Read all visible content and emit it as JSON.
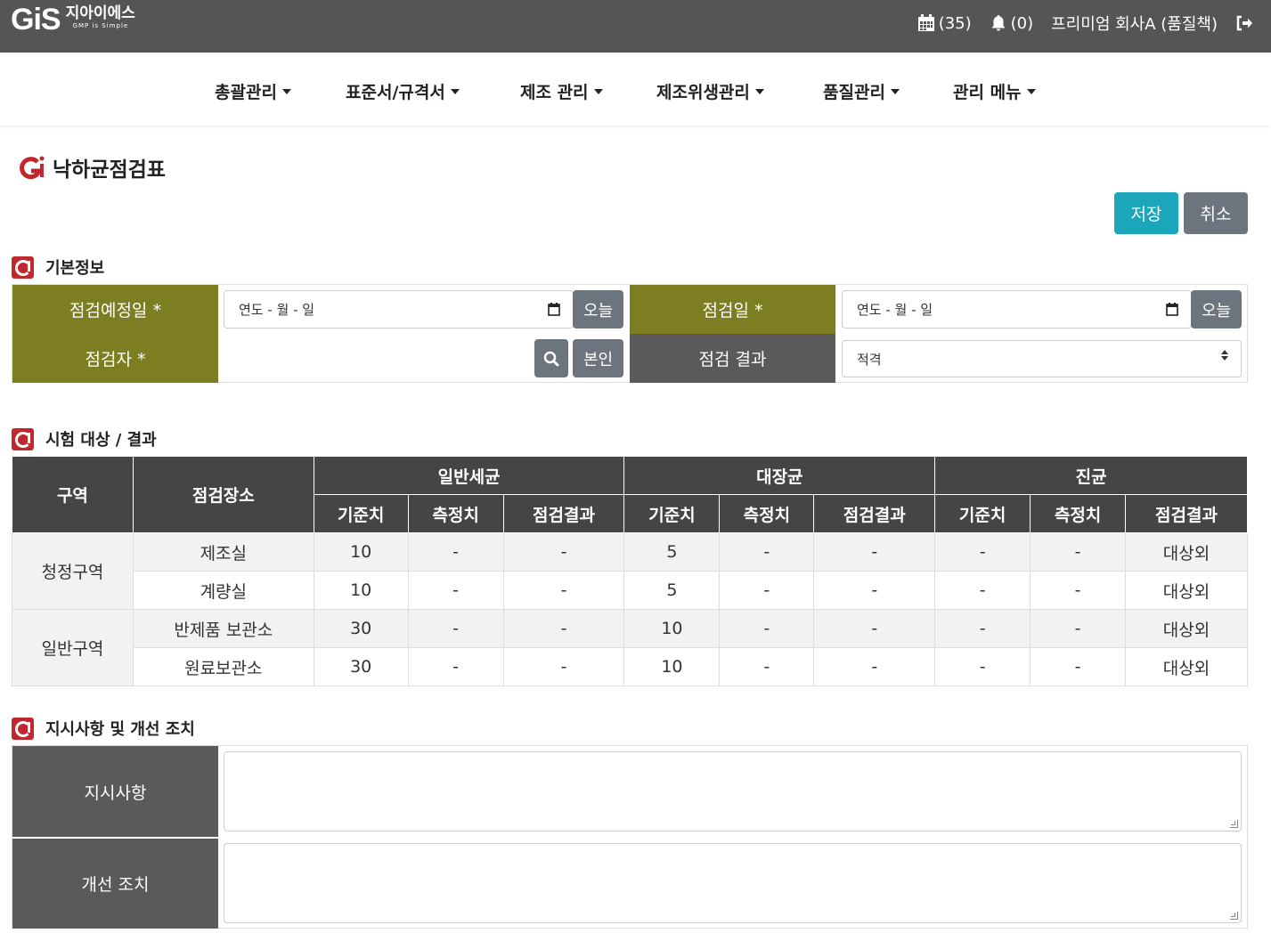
{
  "header": {
    "logo_mark": "GiS",
    "logo_name": "지아이에스",
    "logo_sub": "GMP is Simple",
    "calendar_count": "(35)",
    "notification_count": "(0)",
    "user": "프리미엄 회사A (품질책)"
  },
  "nav": {
    "items": [
      "총괄관리",
      "표준서/규격서",
      "제조 관리",
      "제조위생관리",
      "품질관리",
      "관리 메뉴"
    ]
  },
  "page": {
    "title": "낙하균점검표",
    "save_label": "저장",
    "cancel_label": "취소"
  },
  "basic_info": {
    "section_title": "기본정보",
    "scheduled_date_label": "점검예정일 *",
    "scheduled_date_placeholder": "연도 - 월 - 일",
    "today_label": "오늘",
    "inspection_date_label": "점검일 *",
    "inspection_date_placeholder": "연도 - 월 - 일",
    "inspector_label": "점검자 *",
    "inspector_value": "",
    "self_label": "본인",
    "result_label": "점검 결과",
    "result_value": "적격"
  },
  "results": {
    "section_title": "시험 대상 / 결과",
    "headers": {
      "area": "구역",
      "place": "점검장소",
      "groups": [
        "일반세균",
        "대장균",
        "진균"
      ],
      "sub": [
        "기준치",
        "측정치",
        "점검결과"
      ]
    },
    "areas": [
      "청정구역",
      "일반구역"
    ],
    "rows": [
      {
        "place": "제조실",
        "values": [
          "10",
          "-",
          "-",
          "5",
          "-",
          "-",
          "-",
          "-",
          "대상외"
        ]
      },
      {
        "place": "계량실",
        "values": [
          "10",
          "-",
          "-",
          "5",
          "-",
          "-",
          "-",
          "-",
          "대상외"
        ]
      },
      {
        "place": "반제품 보관소",
        "values": [
          "30",
          "-",
          "-",
          "10",
          "-",
          "-",
          "-",
          "-",
          "대상외"
        ]
      },
      {
        "place": "원료보관소",
        "values": [
          "30",
          "-",
          "-",
          "10",
          "-",
          "-",
          "-",
          "-",
          "대상외"
        ]
      }
    ]
  },
  "instructions": {
    "section_title": "지시사항 및 개선 조치",
    "instruction_label": "지시사항",
    "instruction_value": "",
    "improvement_label": "개선 조치",
    "improvement_value": ""
  },
  "colors": {
    "topbar": "#555555",
    "olive_label": "#7d7e21",
    "gray_label": "#5b595a",
    "table_header": "#454545",
    "save_button": "#1ba6bb",
    "secondary_button": "#6c757d",
    "brand_red": "#c0282e"
  }
}
